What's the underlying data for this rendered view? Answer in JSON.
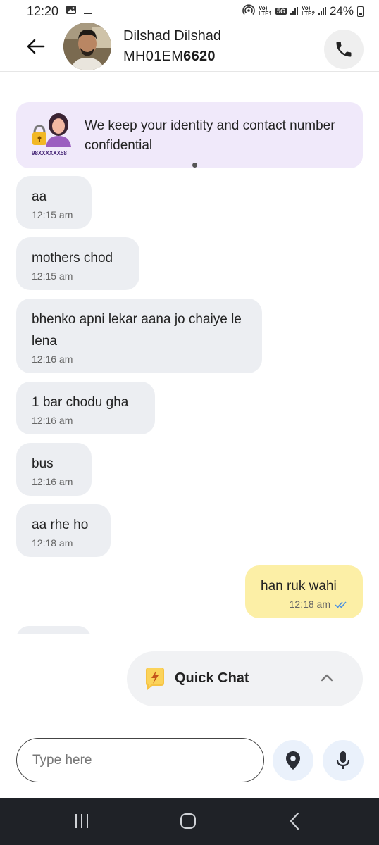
{
  "status_bar": {
    "time": "12:20",
    "network_lte1": [
      "Vo)",
      "LTE1"
    ],
    "network_5g": "5G",
    "network_lte2": [
      "Vo)",
      "LTE2"
    ],
    "battery": "24%"
  },
  "header": {
    "contact_name": "Dilshad Dilshad",
    "plate_prefix": "MH01EM",
    "plate_suffix": "6620"
  },
  "notice": {
    "text": "We keep your identity and contact number confidential",
    "illustration_caption": "98XXXXXX58"
  },
  "messages": [
    {
      "direction": "in",
      "text": "aa",
      "time": "12:15 am"
    },
    {
      "direction": "in",
      "text": "mothers chod",
      "time": "12:15 am"
    },
    {
      "direction": "in",
      "text": "bhenko apni lekar aana jo chaiye le lena",
      "time": "12:16 am"
    },
    {
      "direction": "in",
      "text": "1 bar chodu gha",
      "time": "12:16 am"
    },
    {
      "direction": "in",
      "text": "bus",
      "time": "12:16 am"
    },
    {
      "direction": "in",
      "text": "aa rhe ho",
      "time": "12:18 am"
    },
    {
      "direction": "out",
      "text": "han ruk wahi",
      "time": "12:18 am",
      "status": "read"
    }
  ],
  "quick_chat": {
    "label": "Quick Chat"
  },
  "composer": {
    "placeholder": "Type here",
    "value": ""
  },
  "colors": {
    "incoming_bubble": "#eceef2",
    "outgoing_bubble": "#fcefa6",
    "notice_bg": "#f0e9fa",
    "read_ticks": "#4a90e2",
    "nav_bar": "#1f2227"
  },
  "icons": {
    "back": "arrow-left-icon",
    "call": "phone-icon",
    "quick_chat": "lightning-chat-icon",
    "expand": "chevron-up-icon",
    "location": "location-pin-icon",
    "mic": "microphone-icon",
    "nav_recents": "recents-icon",
    "nav_home": "home-icon",
    "nav_back": "nav-back-icon"
  }
}
